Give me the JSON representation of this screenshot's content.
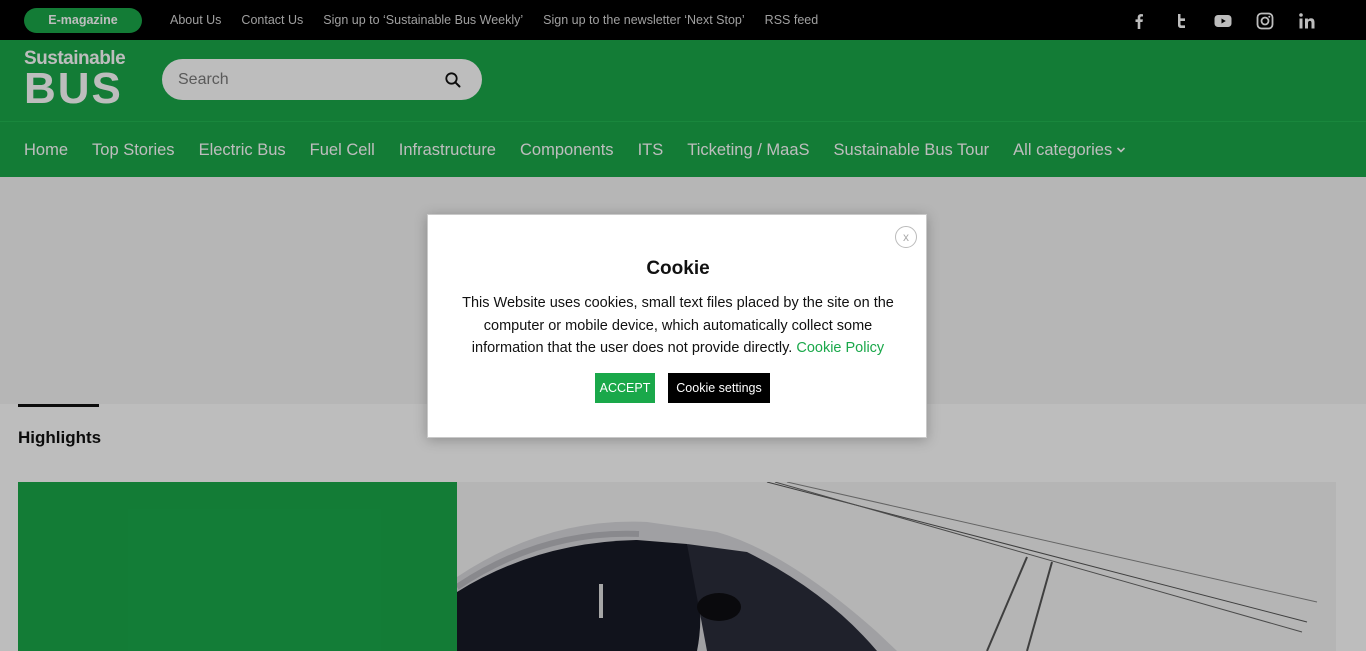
{
  "topbar": {
    "emagazine_label": "E-magazine",
    "links": [
      "About Us",
      "Contact Us",
      "Sign up to ‘Sustainable Bus Weekly’",
      "Sign up to the newsletter ‘Next Stop’",
      "RSS feed"
    ],
    "social_icons": [
      "facebook-icon",
      "twitter-icon",
      "youtube-icon",
      "instagram-icon",
      "linkedin-icon"
    ]
  },
  "header": {
    "logo_top": "Sustainable",
    "logo_bottom": "BUS",
    "search_placeholder": "Search"
  },
  "nav": {
    "items": [
      "Home",
      "Top Stories",
      "Electric Bus",
      "Fuel Cell",
      "Infrastructure",
      "Components",
      "ITS",
      "Ticketing / MaaS",
      "Sustainable Bus Tour",
      "All categories"
    ]
  },
  "main": {
    "highlights_title": "Highlights"
  },
  "cookie_modal": {
    "close_label": "x",
    "title": "Cookie",
    "text": "This Website uses cookies, small text files placed by the site on the computer or mobile device, which automatically collect some information that the user does not provide directly.",
    "policy_link": "Cookie Policy",
    "accept_label": "ACCEPT",
    "settings_label": "Cookie settings"
  },
  "colors": {
    "brand_green": "#1aa84a",
    "topbar": "#000000"
  }
}
